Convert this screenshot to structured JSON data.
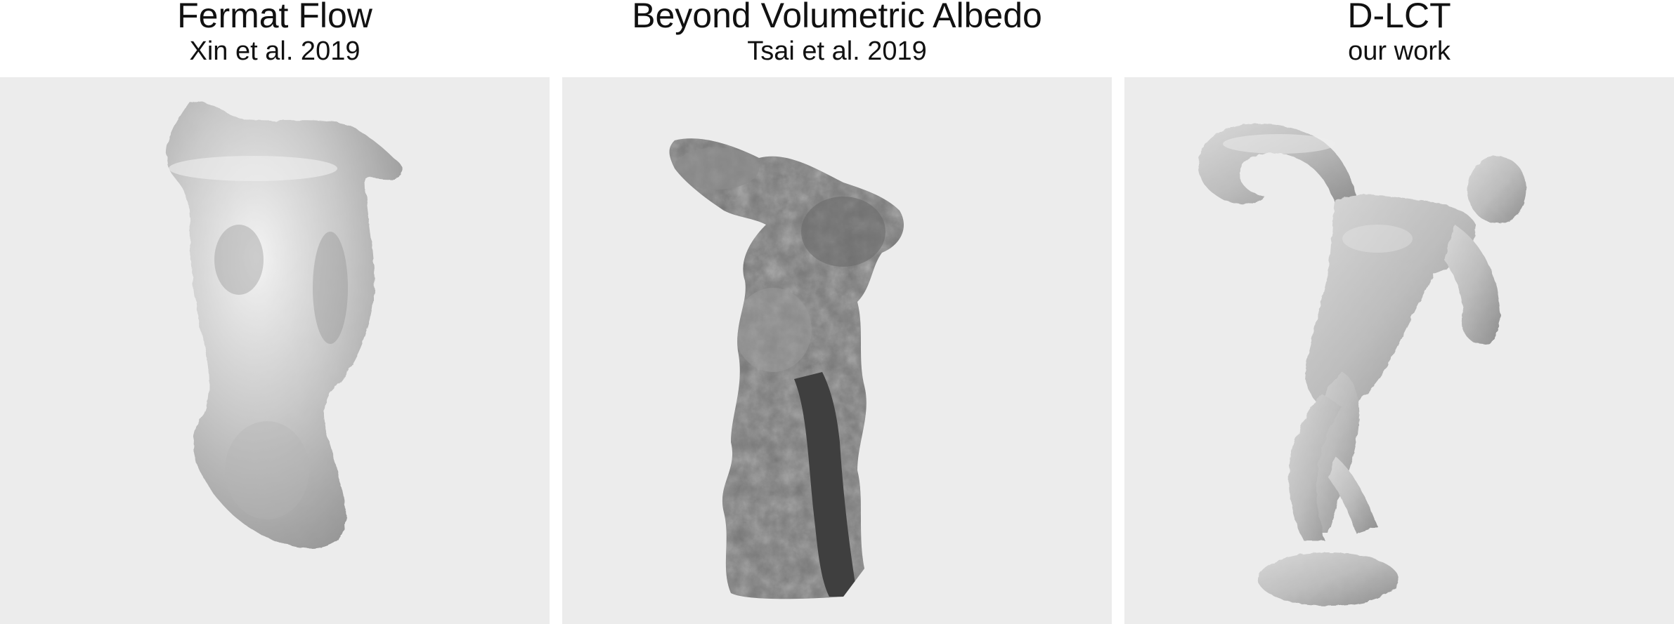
{
  "panels": [
    {
      "title": "Fermat Flow",
      "subtitle": "Xin et al. 2019",
      "image": "reconstruction-blob-render"
    },
    {
      "title": "Beyond Volumetric Albedo",
      "subtitle": "Tsai et al. 2019",
      "image": "reconstruction-noisy-render"
    },
    {
      "title": "D-LCT",
      "subtitle": "our work",
      "image": "discus-thrower-statue-render"
    }
  ],
  "colors": {
    "panel_background": "#ececec",
    "surface_light": "#d4d4d4",
    "surface_mid": "#a9a9a9",
    "surface_dark": "#5e5e5e"
  }
}
